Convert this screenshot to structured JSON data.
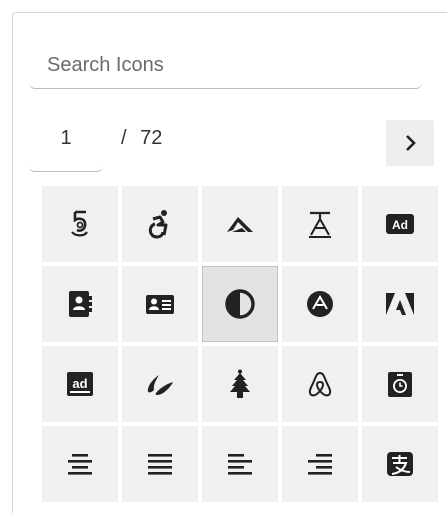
{
  "search": {
    "placeholder": "Search Icons",
    "value": ""
  },
  "pagination": {
    "current": "1",
    "separator": "/",
    "total": "72",
    "next_icon": "chevron-right-icon"
  },
  "icons": [
    {
      "name": "500px-icon"
    },
    {
      "name": "accessible-icon"
    },
    {
      "name": "accusoft-icon"
    },
    {
      "name": "acquisitions-incorporated-icon"
    },
    {
      "name": "ad-icon",
      "label": "Ad"
    },
    {
      "name": "address-book-icon"
    },
    {
      "name": "address-card-icon"
    },
    {
      "name": "adjust-icon",
      "selected": true
    },
    {
      "name": "adn-icon"
    },
    {
      "name": "adobe-icon"
    },
    {
      "name": "adversal-icon"
    },
    {
      "name": "affiliatetheme-icon"
    },
    {
      "name": "air-freshener-icon"
    },
    {
      "name": "airbnb-icon"
    },
    {
      "name": "alarm-clock-icon"
    },
    {
      "name": "align-center-icon"
    },
    {
      "name": "align-justify-icon"
    },
    {
      "name": "align-left-icon"
    },
    {
      "name": "align-right-icon"
    },
    {
      "name": "alipay-icon"
    }
  ],
  "colors": {
    "icon": "#222222",
    "cell": "#f0f0f0",
    "selected_cell": "#e3e3e3",
    "border": "#d6d6d6"
  }
}
